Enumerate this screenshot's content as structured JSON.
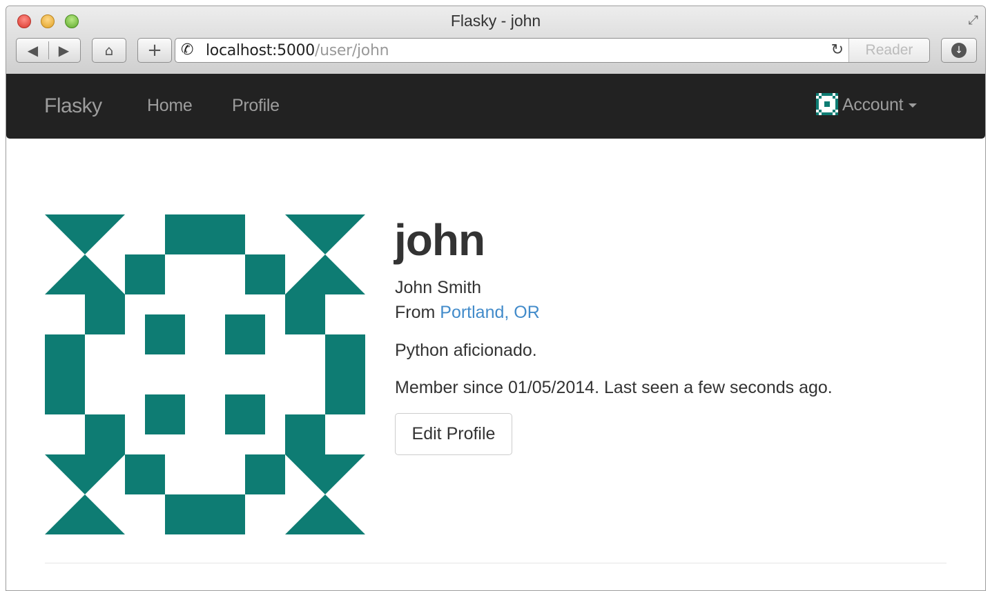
{
  "window": {
    "title": "Flasky - john"
  },
  "toolbar": {
    "back_label": "◀",
    "forward_label": "▶",
    "home_label": "⌂",
    "add_label": "+",
    "url_host": "localhost:5000",
    "url_path": "/user/john",
    "reader_label": "Reader",
    "reload_label": "↻",
    "download_label": "↓"
  },
  "navbar": {
    "brand": "Flasky",
    "links": [
      {
        "label": "Home"
      },
      {
        "label": "Profile"
      }
    ],
    "account_label": "Account",
    "background": "#222222",
    "text_color": "#9d9d9d"
  },
  "profile": {
    "username": "john",
    "name": "John Smith",
    "from_prefix": "From ",
    "location": "Portland, OR",
    "about": "Python aficionado.",
    "member_info": "Member since 01/05/2014. Last seen a few seconds ago.",
    "edit_button": "Edit Profile",
    "avatar_color": "#0e7c73",
    "link_color": "#428bca"
  }
}
